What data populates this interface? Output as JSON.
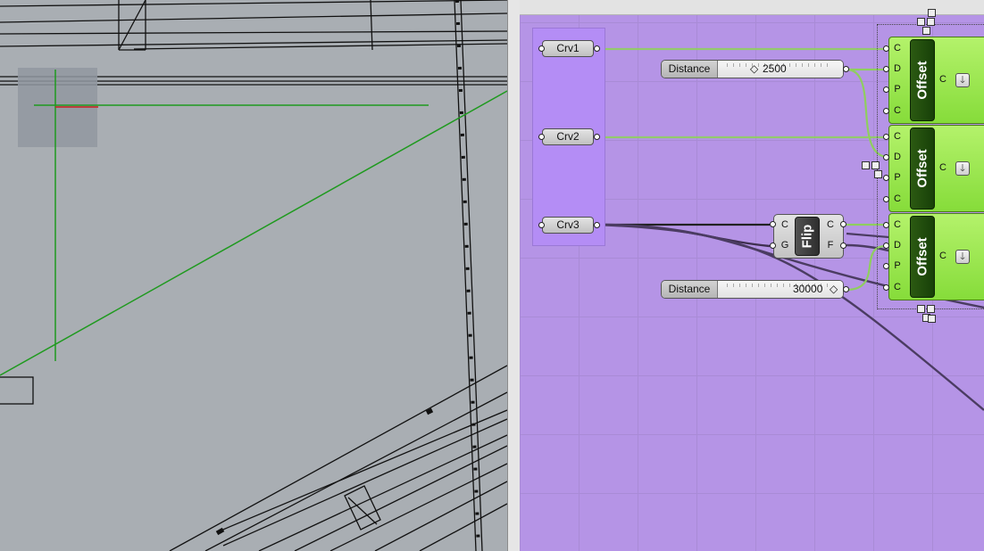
{
  "colors": {
    "viewport_bg": "#a9aeb3",
    "canvas_bg": "#b594e6",
    "group_bg": "#b48df5",
    "component_green": "#9be24d",
    "component_core": "#1f4a0c",
    "wire_green": "#7fd14a",
    "wire_dark": "#4a3a5e",
    "axis_green": "#1f9a1f",
    "axis_red": "#c81e1e"
  },
  "group": {
    "params": [
      {
        "label": "Crv1"
      },
      {
        "label": "Crv2"
      },
      {
        "label": "Crv3"
      }
    ]
  },
  "sliders": [
    {
      "label": "Distance",
      "value": "2500"
    },
    {
      "label": "Distance",
      "value": "30000"
    }
  ],
  "flip": {
    "name": "Flip",
    "inputs": [
      "C",
      "G"
    ],
    "outputs": [
      "C",
      "F"
    ]
  },
  "offsets": [
    {
      "name": "Offset",
      "inputs": [
        "C",
        "D",
        "P",
        "C"
      ],
      "output": "C",
      "dropdown_icon": "down-arrow-icon"
    },
    {
      "name": "Offset",
      "inputs": [
        "C",
        "D",
        "P",
        "C"
      ],
      "output": "C",
      "dropdown_icon": "down-arrow-icon"
    },
    {
      "name": "Offset",
      "inputs": [
        "C",
        "D",
        "P",
        "C"
      ],
      "output": "C",
      "dropdown_icon": "down-arrow-icon"
    }
  ],
  "icons": {
    "slider_diamond": "◇",
    "dropdown": "🡓"
  }
}
